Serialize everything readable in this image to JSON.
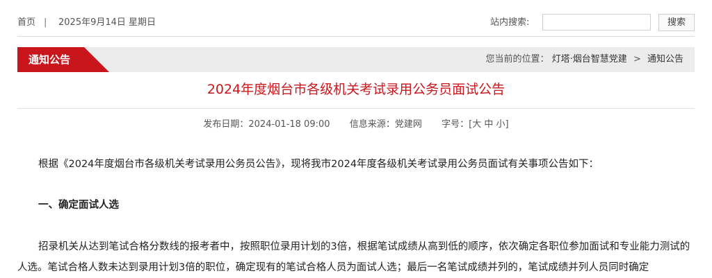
{
  "topbar": {
    "home_label": "首页",
    "separator": "|",
    "date": "2025年9月14日 星期日",
    "search_label": "站内搜索:",
    "search_value": "",
    "search_button": "搜索"
  },
  "section": {
    "title": "通知公告",
    "breadcrumb_prefix": "您当前的位置：",
    "breadcrumb_items": [
      "灯塔·烟台智慧党建",
      "通知公告"
    ],
    "breadcrumb_separator": ">"
  },
  "article": {
    "title": "2024年度烟台市各级机关考试录用公务员面试公告",
    "meta": {
      "publish_label": "发布日期：",
      "publish_date": "2024-01-18 09:00",
      "source_label": "信息来源：",
      "source": "党建网",
      "fontsize_label": "字号：",
      "fontsize_open": "[",
      "fontsize_options": [
        "大",
        "中",
        "小"
      ],
      "fontsize_close": "]"
    },
    "intro": "根据《2024年度烟台市各级机关考试录用公务员公告》，现将我市2024年度各级机关考试录用公务员面试有关事项公告如下：",
    "section1_heading": "一、确定面试人选",
    "section1_body": "招录机关从达到笔试合格分数线的报考者中，按照职位录用计划的3倍，根据笔试成绩从高到低的顺序，依次确定各职位参加面试和专业能力测试的人选。笔试合格人数未达到录用计划3倍的职位，确定现有的笔试合格人员为面试人选；最后一名笔试成绩并列的，笔试成绩并列人员同时确定"
  },
  "colors": {
    "accent": "#c9161c",
    "section_bar_bg": "#ececec"
  }
}
